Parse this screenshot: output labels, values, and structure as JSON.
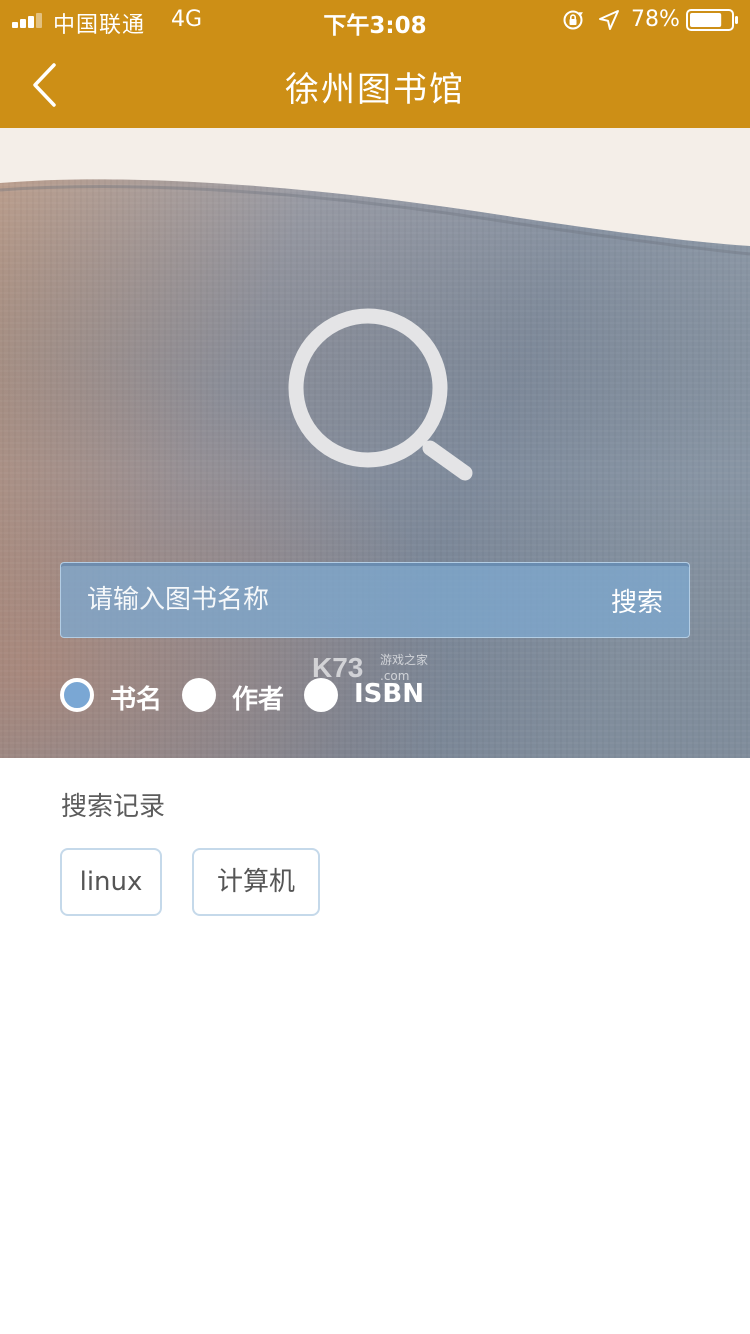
{
  "status_bar": {
    "carrier": "中国联通",
    "network": "4G",
    "time": "下午3:08",
    "battery_percent": "78%",
    "battery_level": 0.78
  },
  "nav": {
    "title": "徐州图书馆",
    "back_icon": "chevron-left-icon"
  },
  "hero": {
    "icon": "search-icon",
    "search": {
      "placeholder": "请输入图书名称",
      "value": "",
      "button_label": "搜索"
    },
    "search_types": [
      {
        "label": "书名",
        "checked": true
      },
      {
        "label": "作者",
        "checked": false
      },
      {
        "label": "ISBN",
        "checked": false
      }
    ],
    "watermark": {
      "brand": "K73",
      "subtitle": "游戏之家",
      "domain": ".com"
    }
  },
  "history": {
    "title": "搜索记录",
    "items": [
      "linux",
      "计算机"
    ]
  },
  "colors": {
    "header": "#cd8f16",
    "search_bar": "#7da8ce",
    "radio_checked": "#7aa7d4",
    "tag_border": "#c5d9ea"
  }
}
